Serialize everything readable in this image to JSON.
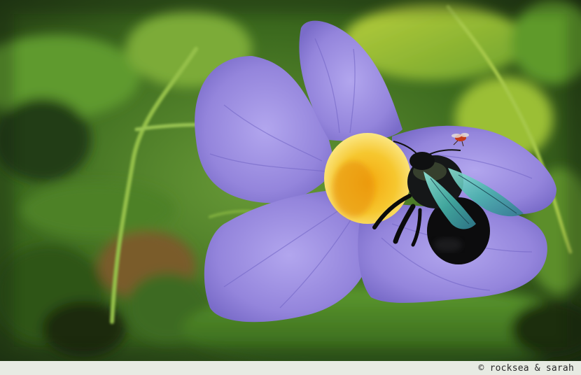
{
  "photo": {
    "subject": "purple-flower-with-carpenter-bee",
    "colors": {
      "petal": "#9c8de0",
      "petal_shadow": "#6f63c2",
      "throat": "#f2b31a",
      "foliage": "#4f8a26",
      "bee_body": "#0d0f10",
      "bee_wing": "#5fd0c0"
    }
  },
  "credit": {
    "text": "© rocksea & sarah"
  }
}
